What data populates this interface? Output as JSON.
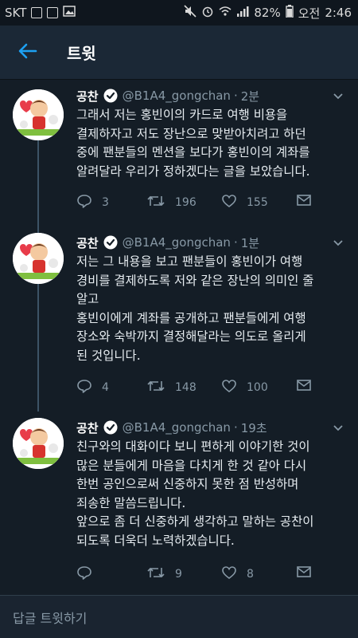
{
  "status_bar": {
    "carrier": "SKT",
    "battery": "82%",
    "ampm": "오전",
    "time": "2:46",
    "icons": [
      "phone-n-icon",
      "box-icon",
      "gallery-icon",
      "mute-icon",
      "alarm-icon",
      "wifi-icon",
      "signal-icon",
      "battery-icon"
    ]
  },
  "header": {
    "title": "트윗",
    "back_icon": "back-arrow-icon",
    "accent": "#1da1f2"
  },
  "colors": {
    "background": "#141d26",
    "header": "#1b2836",
    "secondary": "#8899a6",
    "accent": "#1da1f2"
  },
  "tweets": [
    {
      "name": "공찬",
      "handle": "@B1A4_gongchan",
      "dot": "·",
      "time": "2분",
      "lines": [
        "그래서 저는 홍빈이의 카드로 여행 비용을",
        "결제하자고 저도 장난으로 맞받아치려고 하던",
        "중에 팬분들의 멘션을 보다가 홍빈이의 계좌를",
        "알려달라 우리가 정하겠다는 글을 보았습니다."
      ],
      "replies": "3",
      "retweets": "196",
      "likes": "155"
    },
    {
      "name": "공찬",
      "handle": "@B1A4_gongchan",
      "dot": "·",
      "time": "1분",
      "lines": [
        "저는 그 내용을 보고 팬분들이 홍빈이가 여행",
        "경비를 결제하도록 저와 같은 장난의 의미인 줄",
        "알고",
        "홍빈이에게 계좌를 공개하고 팬분들에게 여행",
        "장소와 숙박까지 결정해달라는 의도로 올리게",
        "된 것입니다."
      ],
      "replies": "4",
      "retweets": "148",
      "likes": "100"
    },
    {
      "name": "공찬",
      "handle": "@B1A4_gongchan",
      "dot": "·",
      "time": "19초",
      "lines": [
        "친구와의 대화이다 보니 편하게 이야기한 것이",
        "많은 분들에게 마음을 다치게 한 것 같아 다시",
        "한번 공인으로써 신중하지 못한 점 반성하며",
        "죄송한 말씀드립니다.",
        "앞으로 좀 더 신중하게 생각하고 말하는 공찬이",
        "되도록 더욱더 노력하겠습니다."
      ],
      "replies": "",
      "retweets": "9",
      "likes": "8"
    }
  ],
  "reply_bar": {
    "placeholder": "답글 트윗하기"
  }
}
